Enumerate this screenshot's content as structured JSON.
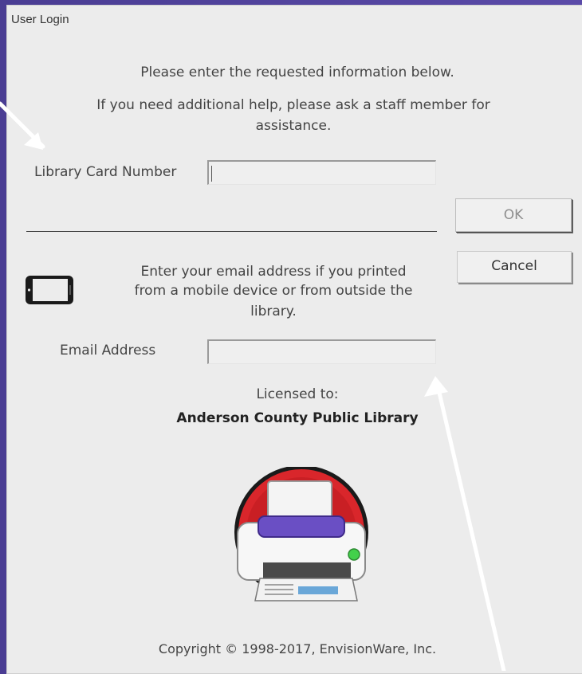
{
  "window": {
    "title": "User Login"
  },
  "intro": {
    "line1": "Please enter the requested information below.",
    "line2a": "If you need additional help, please ask a staff member for",
    "line2b": "assistance."
  },
  "card": {
    "label": "Library Card Number",
    "value": ""
  },
  "buttons": {
    "ok": "OK",
    "cancel": "Cancel"
  },
  "mobile": {
    "icon": "phone-icon",
    "line1": "Enter your email address if you printed",
    "line2": "from a mobile device or from outside the",
    "line3": "library."
  },
  "email": {
    "label": "Email Address",
    "value": ""
  },
  "license": {
    "label": "Licensed to:",
    "name": "Anderson County Public Library"
  },
  "logo": {
    "icon": "printer-logo-icon",
    "colors": {
      "ring": "#d9262b",
      "tray": "#6a4fc4",
      "light": "#43d14b"
    }
  },
  "footer": {
    "copyright": "Copyright © 1998-2017, EnvisionWare, Inc."
  }
}
